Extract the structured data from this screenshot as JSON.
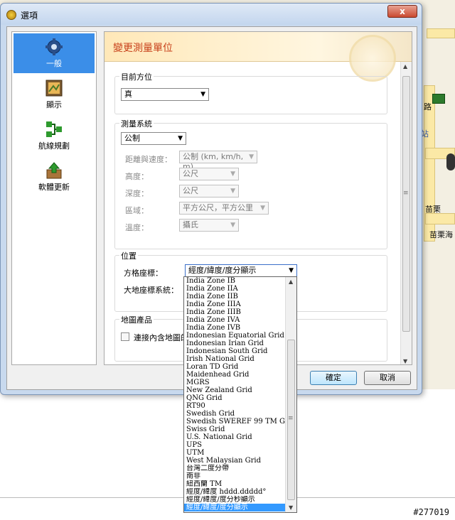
{
  "window": {
    "title": "選項",
    "close_label": "x"
  },
  "nav": {
    "items": [
      {
        "label": "一般",
        "icon": "gear-icon"
      },
      {
        "label": "顯示",
        "icon": "display-icon"
      },
      {
        "label": "航線規劃",
        "icon": "route-icon"
      },
      {
        "label": "軟體更新",
        "icon": "update-icon"
      }
    ],
    "selected": 0
  },
  "panel": {
    "title": "變更測量單位",
    "heading_direction": {
      "group_label": "目前方位",
      "value": "真"
    },
    "measurement_system": {
      "group_label": "測量系統",
      "value": "公制",
      "rows": [
        {
          "label": "距離與速度：",
          "value": "公制 (km, km/h, m)"
        },
        {
          "label": "高度：",
          "value": "公尺"
        },
        {
          "label": "深度：",
          "value": "公尺"
        },
        {
          "label": "區域：",
          "value": "平方公尺，平方公里"
        },
        {
          "label": "溫度：",
          "value": "攝氏"
        }
      ]
    },
    "position": {
      "group_label": "位置",
      "grid_label": "方格座標：",
      "grid_value": "經度/緯度/度分顯示",
      "datum_label": "大地座標系統："
    },
    "map_product": {
      "group_label": "地圖產品",
      "checkbox_label": "連接內含地圖的"
    }
  },
  "buttons": {
    "ok": "確定",
    "cancel": "取消"
  },
  "dropdown": {
    "items": [
      "India Zone IB",
      "India Zone IIA",
      "India Zone IIB",
      "India Zone IIIA",
      "India Zone IIIB",
      "India Zone IVA",
      "India Zone IVB",
      "Indonesian Equatorial Grid",
      "Indonesian Irian Grid",
      "Indonesian South Grid",
      "Irish National Grid",
      "Loran TD Grid",
      "Maidenhead Grid",
      "MGRS",
      "New Zealand Grid",
      "QNG Grid",
      "RT90",
      "Swedish Grid",
      "Swedish SWEREF 99 TM Grid",
      "Swiss Grid",
      "U.S. National Grid",
      "UPS",
      "UTM",
      "West Malaysian Grid",
      "台灣二度分帶",
      "南非",
      "紐西蘭 TM",
      "經度/緯度 hddd.ddddd°",
      "經度/緯度/度分秒顯示",
      "經度/緯度/度分顯示"
    ],
    "selected_index": 29
  },
  "map": {
    "labels": [
      "路",
      "站",
      "苗栗",
      "苗栗海"
    ],
    "watermark": "#277019"
  }
}
